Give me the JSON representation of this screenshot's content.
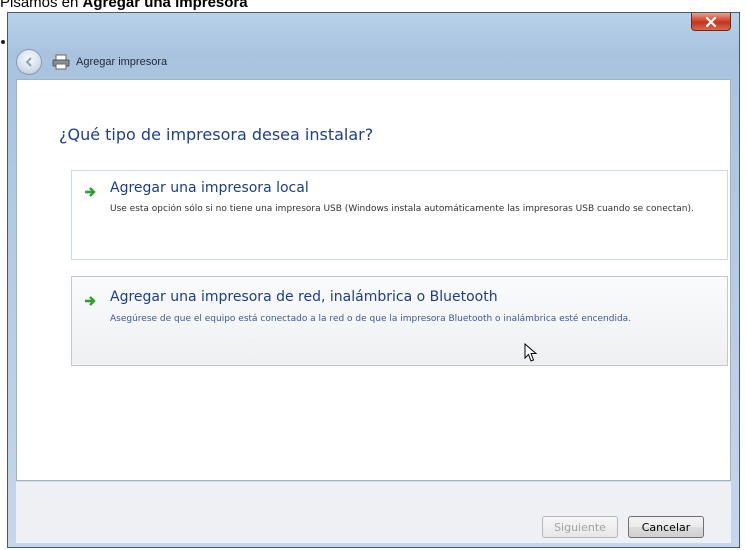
{
  "caption": {
    "prefix": "Pisamos en ",
    "bold": "Agregar una impresora"
  },
  "window": {
    "title": "Agregar impresora",
    "close_icon": "close-icon",
    "back_icon": "back-arrow-icon",
    "printer_icon": "printer-icon"
  },
  "main": {
    "heading": "¿Qué tipo de impresora desea instalar?",
    "options": [
      {
        "title": "Agregar una impresora local",
        "description": "Use esta opción sólo si no tiene una impresora USB (Windows instala automáticamente las impresoras USB cuando se conectan)."
      },
      {
        "title": "Agregar una impresora de red, inalámbrica o Bluetooth",
        "description": "Asegúrese de que el equipo está conectado a la red o de que la impresora Bluetooth o inalámbrica esté encendida."
      }
    ]
  },
  "footer": {
    "next_label": "Siguiente",
    "cancel_label": "Cancelar"
  },
  "colors": {
    "accent": "#1d3d89",
    "arrow_green": "#2f9e2f",
    "close_red": "#c0361d"
  }
}
